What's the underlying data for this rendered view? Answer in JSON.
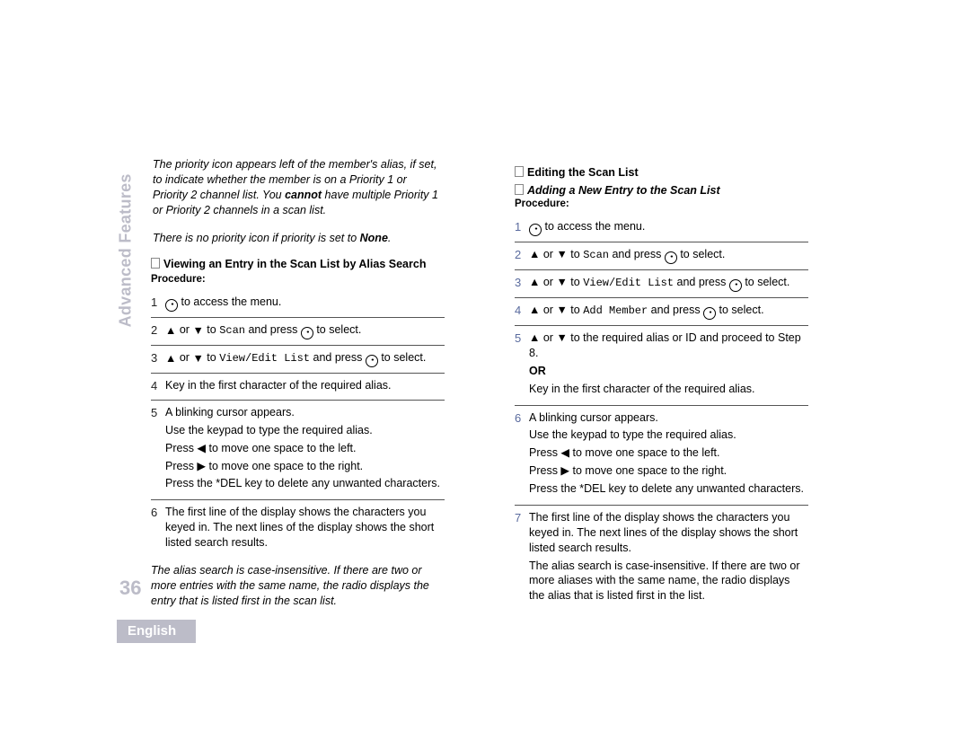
{
  "sidebar_label": "Advanced Features",
  "page_number": "36",
  "language": "English",
  "left": {
    "intro1_a": "The priority icon appears left of the member's alias, if set, to indicate whether the member is on a Priority 1 or Priority 2 channel list. You ",
    "intro1_b": "cannot",
    "intro1_c": " have multiple Priority 1 or Priority 2 channels in a scan list.",
    "intro2_a": "There is no priority icon if priority is set to ",
    "intro2_b": "None",
    "intro2_c": ".",
    "heading": "Viewing an Entry in the Scan List by Alias Search",
    "procedure": "Procedure:",
    "steps": {
      "s1": " to access the menu.",
      "s2_a": " or ",
      "s2_b": " to ",
      "s2_scan": "Scan",
      "s2_c": " and press ",
      "s2_d": " to select.",
      "s3_a": " or ",
      "s3_b": " to ",
      "s3_vel": "View/Edit List",
      "s3_c": " and press ",
      "s3_d": " to select.",
      "s4": "Key in the first character of the required alias.",
      "s5_l1": "A blinking cursor appears.",
      "s5_l2": "Use the keypad to type the required alias.",
      "s5_l3": "Press ◀ to move one space to the left.",
      "s5_l4": "Press ▶ to move one space to the right.",
      "s5_l5": "Press the *DEL key to delete any unwanted characters.",
      "s6": "The first line of the display shows the characters you keyed in. The next lines of the display shows the short listed search results."
    },
    "note": "The alias search is case-insensitive. If there are two or more entries with the same name, the radio displays the entry that is listed first in the scan list."
  },
  "right": {
    "heading": "Editing the Scan List",
    "subheading": "Adding a New Entry to the Scan List",
    "procedure": "Procedure:",
    "steps": {
      "s1": " to access the menu.",
      "s2_a": " or ",
      "s2_b": " to ",
      "s2_scan": "Scan",
      "s2_c": " and press ",
      "s2_d": " to select.",
      "s3_a": " or ",
      "s3_b": " to ",
      "s3_vel": "View/Edit List",
      "s3_c": " and press ",
      "s3_d": " to select.",
      "s4_a": " or ",
      "s4_b": " to ",
      "s4_add": "Add Member",
      "s4_c": " and press ",
      "s4_d": " to select.",
      "s5_l1a": " or ",
      "s5_l1b": " to the required alias or ID and proceed to Step 8.",
      "s5_or": "OR",
      "s5_l2": "Key in the first character of the required alias.",
      "s6_l1": "A blinking cursor appears.",
      "s6_l2": "Use the keypad to type the required alias.",
      "s6_l3": "Press ◀ to move one space to the left.",
      "s6_l4": "Press ▶ to move one space to the right.",
      "s6_l5": "Press the *DEL key to delete any unwanted characters.",
      "s7_l1": "The first line of the display shows the characters you keyed in. The next lines of the display shows the short listed search results.",
      "s7_l2": "The alias search is case-insensitive. If there are two or more aliases with the same name, the radio displays the alias that is listed first in the list."
    }
  }
}
